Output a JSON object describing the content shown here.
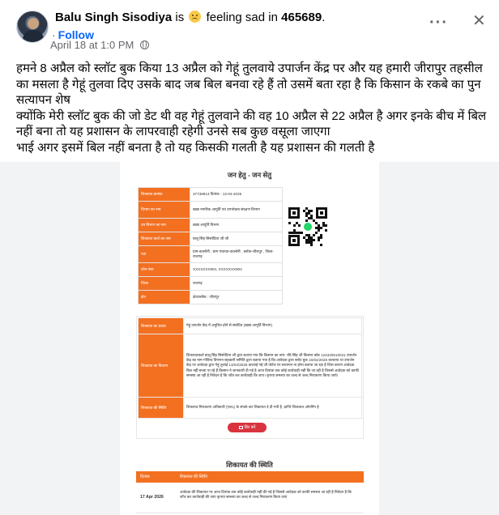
{
  "post": {
    "author": "Balu Singh Sisodiya",
    "is_word": "is",
    "feeling": "feeling sad in",
    "group": "465689",
    "group_suffix": ".",
    "follow_label": "Follow",
    "timestamp": "April 18 at 1:0",
    "timestamp_suffix": "PM",
    "emoji_icon": "sad-face-icon",
    "privacy_icon": "globe-icon",
    "more_label": "···",
    "close_label": "✕",
    "paragraphs": [
      "हमने 8 अप्रैल को स्लॉट बुक किया 13 अप्रैल को गेहूं तुलवाये उपार्जन केंद्र पर और यह हमारी जीरापुर तहसील का मसला है गेहूं तुलवा दिए उसके बाद जब बिल बनवा रहे हैं तो उसमें बता रहा है कि किसान के रकबे का पुन सत्यापन शेष",
      "क्योंकि मेरी स्लॉट बुक की जो डेट थी वह गेहूं तुलवाने की वह 10 अप्रैल से 22 अप्रैल है अगर इनके बीच में बिल नहीं बना तो यह प्रशासन के लापरवाही रहेगी उनसे सब कुछ वसूला जाएगा",
      "भाई अगर इसमें बिल नहीं बनता है तो यह किसकी गलती है यह प्रशासन की गलती है"
    ]
  },
  "document": {
    "title": "जन हेतु - जन सेतु",
    "info_rows": [
      {
        "label": "शिकायत क्रमांक",
        "value": "37738913 दिनांक - 13-04-2026"
      },
      {
        "label": "विभाग का नाम",
        "value": "खाद्य नागरिक आपूर्ति एवं उपभोक्ता संरक्षण विभाग"
      },
      {
        "label": "उप विभाग का नाम",
        "value": "खाद्य आपूर्ति विभाग"
      },
      {
        "label": "शिकायत कर्ता का नाम",
        "value": "बालू सिंह सिसोदिया जी जी"
      },
      {
        "label": "पता",
        "value": "ग्राम-कालोनी , ग्राम पंचायत-कालोनी , ब्लॉक-जीरापुर , जिला-राजगढ़"
      },
      {
        "label": "फ़ोन नंबर",
        "value": "XXXXXXX904, XXXXXXX904"
      },
      {
        "label": "जिला",
        "value": "राजगढ़"
      },
      {
        "label": "क्षेत्र",
        "value": "क्षेत्र/ब्लॉक : जीरापुर"
      }
    ],
    "details_rows": [
      {
        "label": "शिकायत का प्रकार",
        "value": "गेहूं उपार्जन केंद्र में अनुचित होने से संबंधित (खाद्य आपूर्ति विभाग)"
      },
      {
        "label": "शिकायत का विवरण",
        "value": "शिकायतकर्ता बालू सिंह सिसोदिया जी द्वारा बताया गया कि किसान का नाम- रवि सिंह जी किसान कोड 124320510021 उपार्जन केंद्र का नाम गोविन्द विपणन सहकारी समिति द्वारा बताया गया है कि-आवेदक द्वारा स्लॉट बुक 10/04/2026 करवाया था उपार्जन केंद्र पर आवेदक द्वारा गेहूं तुलाई 13/04/2026 करवाई गई जी पोर्टल पर सत्यापन ना होना बताया जा रहा है जिस कारण आवेदक बिल नहीं बनवा पा रहे हैं किसान ने जानकारी दी गई है आज दिनांक तक कोई कार्यवाही नहीं कि जा रही है जिससे आवेदक को काफी समस्या आ रही है निवेदन है कि जाँच कर कार्यवाही कि जाए। कृपया समस्या का जल्द से जल्द निराकरण किया जाये।"
      },
      {
        "label": "शिकायत की स्थिति",
        "value": "शिकायत निराकरण अधिकारी (एल1) के संपर्क कर शिकायत दे दी गयी है ,प्राप्ति शिकायत ओपनिंग है"
      }
    ],
    "print_label": "प्रिंट करें",
    "print_icon": "printer-icon",
    "status_title": "शिकायत की स्थिति",
    "status_header": {
      "date": "दिनांक",
      "status": "शिकायत की स्थिति"
    },
    "status_rows": [
      {
        "date": "17 Apr 2026",
        "text": "आवेदक की शिकायत पर आज दिनांक तक कोई कार्यवाही नहीं की गई है जिससे आवेदक को काफी समस्या आ रही है निवेदन है कि जाँच कर कार्यवाही की जाए कृपया समस्या का जल्द से जल्द निराकरण किया जाए"
      }
    ]
  },
  "colors": {
    "accent_orange": "#f37021",
    "link_blue": "#0866ff",
    "print_red": "#d9333f"
  }
}
